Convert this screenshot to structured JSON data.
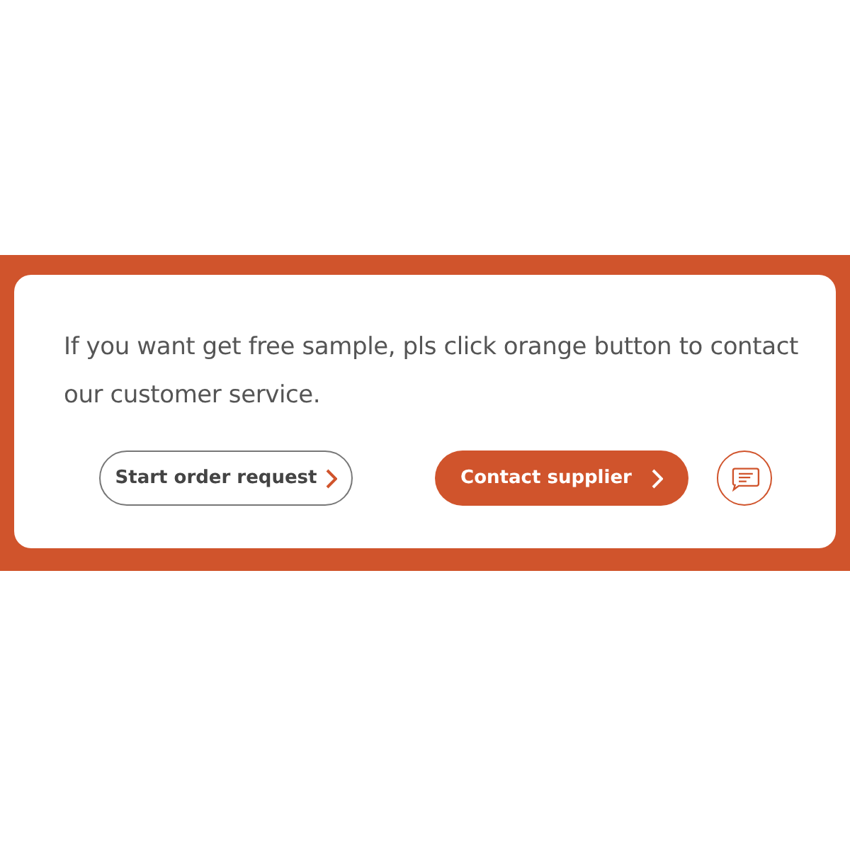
{
  "message": "If you want get free sample, pls click orange button to contact our customer service.",
  "buttons": [
    {
      "label": "Start order request",
      "kind": "outline"
    },
    {
      "label": "Contact supplier",
      "kind": "primary"
    }
  ],
  "chat_button": {
    "kind": "chat"
  }
}
